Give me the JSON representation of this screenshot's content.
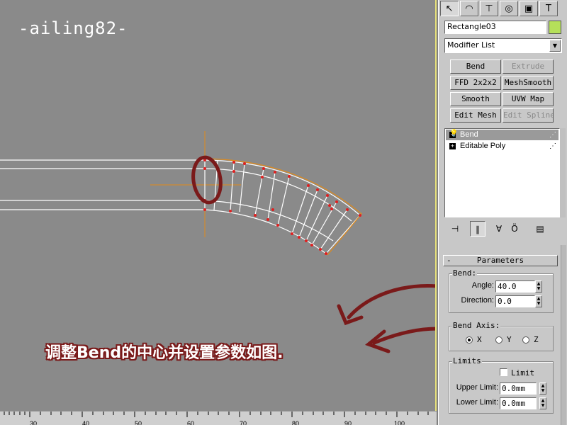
{
  "watermark": "-ailing82-",
  "caption": "调整Bend的中心并设置参数如图.",
  "ruler": {
    "labels": [
      "30",
      "40",
      "50",
      "60",
      "70",
      "80",
      "90",
      "100"
    ]
  },
  "panel": {
    "tabs": [
      {
        "icon": "create-cursor-icon",
        "glyph": "↖"
      },
      {
        "icon": "modify-arc-icon",
        "glyph": "◠"
      },
      {
        "icon": "hierarchy-icon",
        "glyph": "⊤"
      },
      {
        "icon": "motion-icon",
        "glyph": "◎"
      },
      {
        "icon": "display-icon",
        "glyph": "▣"
      },
      {
        "icon": "utilities-hammer-icon",
        "glyph": "T"
      }
    ],
    "object_name": "Rectangle03",
    "object_color": "#b5e05a",
    "modifier_list": "Modifier List",
    "modifier_buttons": [
      {
        "label": "Bend",
        "enabled": true
      },
      {
        "label": "Extrude",
        "enabled": false
      },
      {
        "label": "FFD 2x2x2",
        "enabled": true
      },
      {
        "label": "MeshSmooth",
        "enabled": true
      },
      {
        "label": "Smooth",
        "enabled": true
      },
      {
        "label": "UVW Map",
        "enabled": true
      },
      {
        "label": "Edit Mesh",
        "enabled": true
      },
      {
        "label": "Edit Spline",
        "enabled": false
      }
    ],
    "stack": [
      {
        "label": "Bend",
        "selected": true
      },
      {
        "label": "Editable Poly",
        "selected": false
      }
    ],
    "parameters": {
      "title": "Parameters",
      "bend_group": "Bend:",
      "angle_label": "Angle:",
      "angle_value": "40.0",
      "direction_label": "Direction:",
      "direction_value": "0.0",
      "bend_axis_group": "Bend Axis:",
      "axes": [
        "X",
        "Y",
        "Z"
      ],
      "selected_axis": "X",
      "limits_group": "Limits",
      "limit_label": "Limit",
      "upper_limit_label": "Upper Limit:",
      "upper_limit_value": "0.0mm",
      "lower_limit_label": "Lower Limit:",
      "lower_limit_value": "0.0mm"
    }
  },
  "colors": {
    "annotation": "#7a1a1a",
    "wire": "#ffffff",
    "gizmo": "#e08a1a",
    "vertex": "#e02020"
  }
}
